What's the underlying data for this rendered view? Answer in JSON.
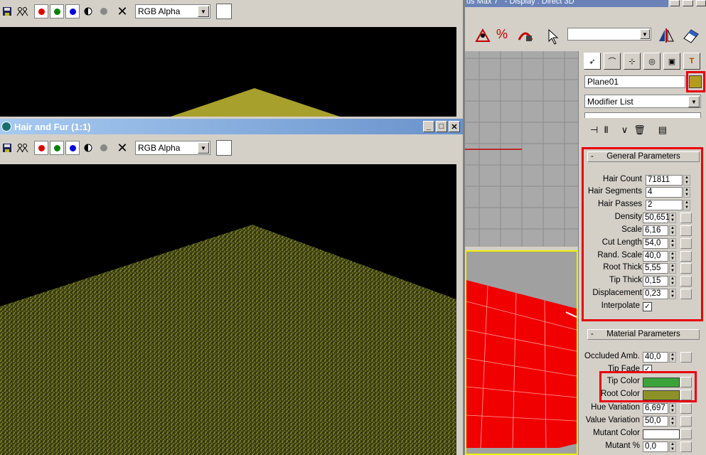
{
  "top_title": "us Max 7   - Display : Direct 3D",
  "toolbar": {
    "channel_value": "RGB Alpha",
    "icons": [
      "save-icon",
      "clone-icon",
      "red-channel",
      "green-channel",
      "blue-channel",
      "mono-icon",
      "alpha-icon",
      "clear-icon"
    ]
  },
  "fur_window": {
    "title": "Hair and Fur (1:1)",
    "min": "_",
    "max": "□",
    "close": "✕"
  },
  "command_panel": {
    "object_name": "Plane01",
    "object_color": "#b59a20",
    "modifier_list": "Modifier List"
  },
  "general": {
    "title": "General Parameters",
    "collapse": "-",
    "params": [
      {
        "label": "Hair Count",
        "value": "71811"
      },
      {
        "label": "Hair Segments",
        "value": "4"
      },
      {
        "label": "Hair Passes",
        "value": "2"
      },
      {
        "label": "Density",
        "value": "50,651"
      },
      {
        "label": "Scale",
        "value": "6,16"
      },
      {
        "label": "Cut Length",
        "value": "54,0"
      },
      {
        "label": "Rand. Scale",
        "value": "40,0"
      },
      {
        "label": "Root Thick",
        "value": "5,55"
      },
      {
        "label": "Tip Thick",
        "value": "0,15"
      },
      {
        "label": "Displacement",
        "value": "0,23"
      }
    ],
    "interpolate_label": "Interpolate",
    "interpolate_check": "✓"
  },
  "material": {
    "title": "Material Parameters",
    "collapse": "-",
    "occluded_label": "Occluded Amb.",
    "occluded_value": "40,0",
    "tipfade_label": "Tip Fade",
    "tip_label": "Tip Color",
    "tip_color": "#3aa43a",
    "root_label": "Root Color",
    "root_color": "#8c9228",
    "hue_label": "Hue Variation",
    "hue_value": "6,697",
    "valvar_label": "Value Variation",
    "valvar_value": "50,0",
    "mutant_label": "Mutant Color",
    "mutant_color": "#ffffff",
    "mutantpct_label": "Mutant %",
    "mutantpct_value": "0,0"
  }
}
